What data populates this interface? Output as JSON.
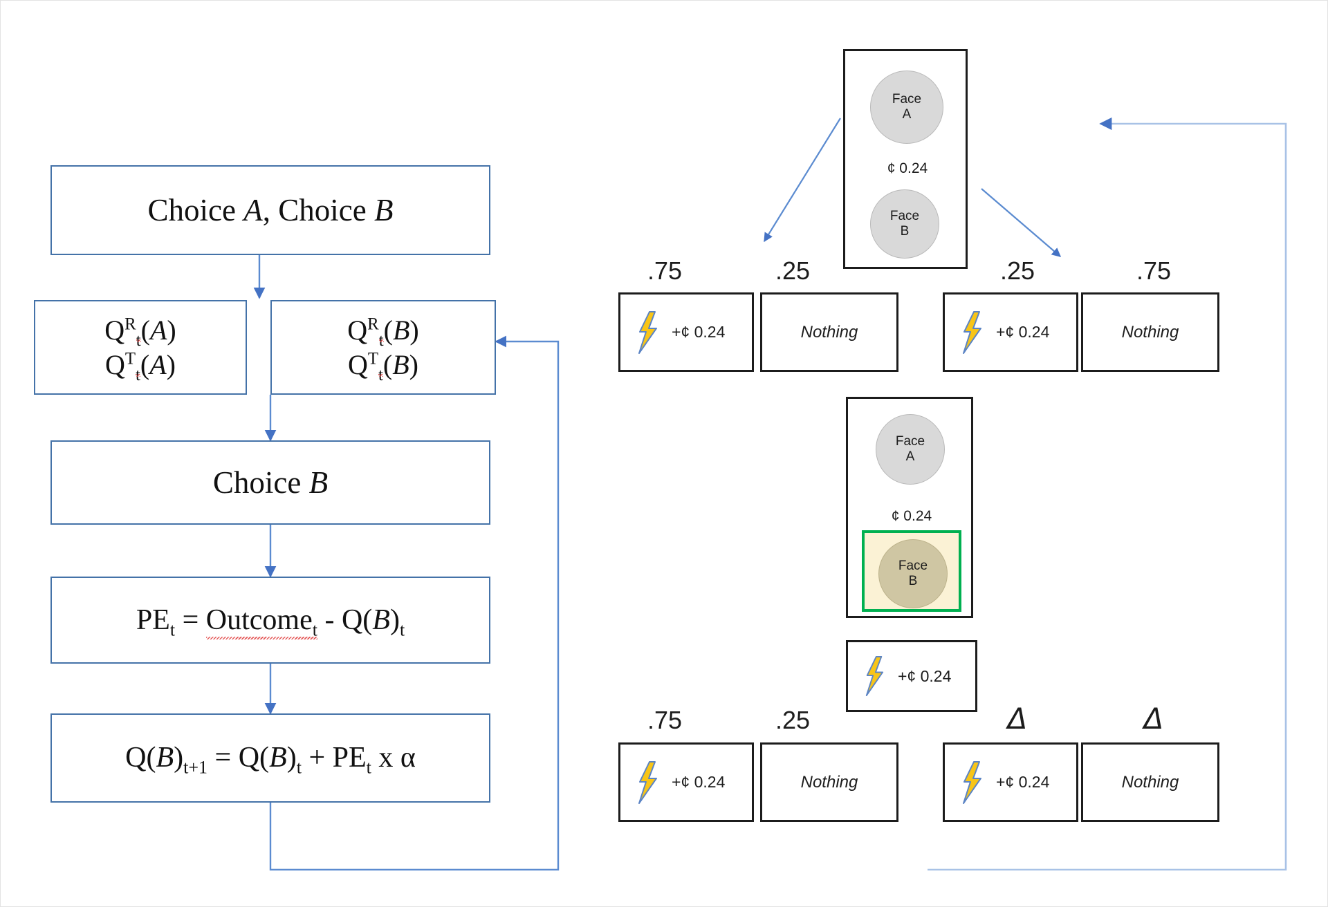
{
  "flowchart": {
    "boxes": [
      {
        "id": "choice-ab",
        "text": "Choice A, Choice B"
      },
      {
        "id": "q-a",
        "line1": "Q",
        "line1_sup": "R",
        "line1_sub": "t",
        "line1_arg": "(A)",
        "line2": "Q",
        "line2_sup": "T",
        "line2_sub": "t",
        "line2_arg": "(A)"
      },
      {
        "id": "q-b",
        "line1": "Q",
        "line1_sup": "R",
        "line1_sub": "t",
        "line1_arg": "(B)",
        "line2": "Q",
        "line2_sup": "T",
        "line2_sub": "t",
        "line2_arg": "(B)"
      },
      {
        "id": "choice-b",
        "text": "Choice B"
      },
      {
        "id": "pe",
        "text": "PE_t = Outcome_t - Q(B)_t"
      },
      {
        "id": "update",
        "text": "Q(B)_{t+1} = Q(B)_t + PE_t x α"
      }
    ],
    "labels": {
      "choice_ab": "Choice A, Choice B",
      "choice_b": "Choice B",
      "q_symbol": "Q",
      "sup_r": "R",
      "sup_t": "T",
      "sub_t": "t",
      "sub_t1": "t+1",
      "arg_a": "(A)",
      "arg_b": "(B)",
      "pe": "PE",
      "outcome": "Outcome",
      "equals": "=",
      "minus": "-",
      "plus": "+",
      "times": "x",
      "alpha": "α",
      "q_open": "Q(",
      "q_close": ")",
      "italic_a": "A",
      "italic_b": "B"
    }
  },
  "task": {
    "stimulus_top": {
      "face_a": {
        "line1": "Face",
        "line2": "A"
      },
      "face_b": {
        "line1": "Face",
        "line2": "B"
      },
      "cents": "¢ 0.24"
    },
    "stimulus_mid": {
      "face_a": {
        "line1": "Face",
        "line2": "A"
      },
      "face_b": {
        "line1": "Face",
        "line2": "B"
      },
      "cents": "¢ 0.24",
      "selected": "face_b",
      "selection_border_color": "#00b050",
      "selection_fill_color": "#fbf2d5"
    },
    "outcomes_top": [
      {
        "prob": ".75",
        "type": "reward",
        "amount": "+¢ 0.24"
      },
      {
        "prob": ".25",
        "type": "nothing",
        "label": "Nothing"
      },
      {
        "prob": ".25",
        "type": "reward",
        "amount": "+¢ 0.24"
      },
      {
        "prob": ".75",
        "type": "nothing",
        "label": "Nothing"
      }
    ],
    "outcome_selected": {
      "type": "reward",
      "amount": "+¢ 0.24"
    },
    "outcomes_bottom": [
      {
        "prob": ".75",
        "type": "reward",
        "amount": "+¢ 0.24"
      },
      {
        "prob": ".25",
        "type": "nothing",
        "label": "Nothing"
      },
      {
        "prob": "Δ",
        "is_delta": true,
        "type": "reward",
        "amount": "+¢ 0.24"
      },
      {
        "prob": "Δ",
        "is_delta": true,
        "type": "nothing",
        "label": "Nothing"
      }
    ],
    "icons": {
      "bolt": "lightning-bolt-icon",
      "bolt_fill": "#f8c517",
      "bolt_stroke": "#5b84c4"
    }
  },
  "colors": {
    "flow_border": "#4472a8",
    "arrow_blue": "#4472c4",
    "box_black": "#1c1c1c",
    "face_gray": "#d9d9d9",
    "face_selected": "#cfc6a3",
    "green": "#00b050",
    "cream": "#fbf2d5"
  }
}
